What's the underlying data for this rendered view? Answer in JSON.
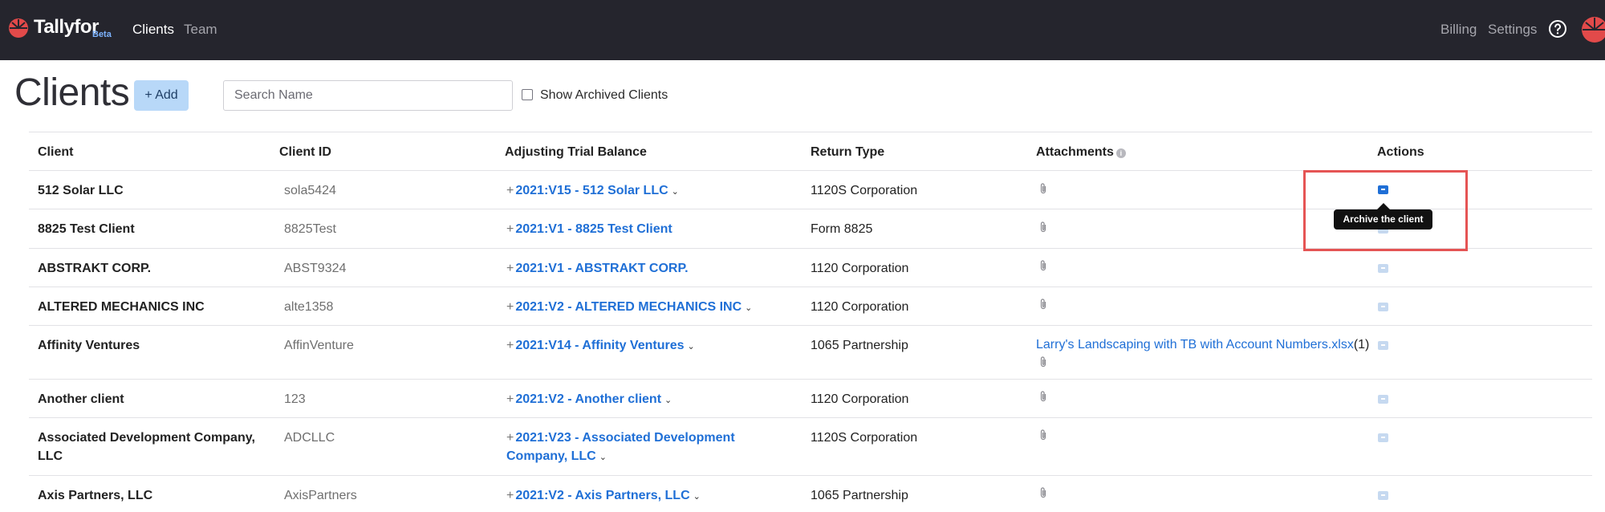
{
  "navbar": {
    "brand": "Tallyfor",
    "beta": "Beta",
    "links": {
      "clients": "Clients",
      "team": "Team"
    },
    "right_links": {
      "billing": "Billing",
      "settings": "Settings"
    }
  },
  "header": {
    "title": "Clients",
    "add_label": "+ Add",
    "search_placeholder": "Search Name",
    "archived_label": "Show Archived Clients",
    "archived_checked": false
  },
  "table": {
    "columns": {
      "client": "Client",
      "client_id": "Client ID",
      "atb": "Adjusting Trial Balance",
      "return_type": "Return Type",
      "attachments": "Attachments",
      "actions": "Actions"
    },
    "rows": [
      {
        "client": "512 Solar LLC",
        "client_id": "sola5424",
        "atb": "2021:V15 - 512 Solar LLC",
        "atb_dropdown": true,
        "return_type": "1120S Corporation"
      },
      {
        "client": "8825 Test Client",
        "client_id": "8825Test",
        "atb": "2021:V1 - 8825 Test Client",
        "atb_dropdown": false,
        "return_type": "Form 8825"
      },
      {
        "client": "ABSTRAKT CORP.",
        "client_id": "ABST9324",
        "atb": "2021:V1 - ABSTRAKT CORP.",
        "atb_dropdown": false,
        "return_type": "1120 Corporation"
      },
      {
        "client": "ALTERED MECHANICS INC",
        "client_id": "alte1358",
        "atb": "2021:V2 - ALTERED MECHANICS INC",
        "atb_dropdown": true,
        "return_type": "1120 Corporation"
      },
      {
        "client": "Affinity Ventures",
        "client_id": "AffinVenture",
        "atb": "2021:V14 - Affinity Ventures",
        "atb_dropdown": true,
        "return_type": "1065 Partnership",
        "attachment_file": "Larry's Landscaping with TB with Account Numbers.xlsx",
        "attachment_count": "(1)"
      },
      {
        "client": "Another client",
        "client_id": "123",
        "atb": "2021:V2 - Another client",
        "atb_dropdown": true,
        "return_type": "1120 Corporation"
      },
      {
        "client_line1": "Associated Development Company,",
        "client_line2": "LLC",
        "client_id": "ADCLLC",
        "atb_line1": "2021:V23 - Associated Development",
        "atb_line2": "Company, LLC",
        "atb_dropdown": true,
        "return_type": "1120S Corporation"
      },
      {
        "client": "Axis Partners, LLC",
        "client_id": "AxisPartners",
        "atb": "2021:V2 - Axis Partners, LLC",
        "atb_dropdown": true,
        "return_type": "1065 Partnership"
      }
    ]
  },
  "tooltip": {
    "text": "Archive the client"
  },
  "icons": {
    "logo": "tallyfor-logo-icon",
    "help": "help-circle-icon",
    "paperclip": "paperclip-icon",
    "archive": "archive-icon",
    "info": "info-icon"
  },
  "colors": {
    "navbar_bg": "#25252d",
    "link_blue": "#1f6fd6",
    "add_button_bg": "#b8d8f8",
    "highlight_red": "#e55454",
    "brand_red": "#e24a4a"
  }
}
